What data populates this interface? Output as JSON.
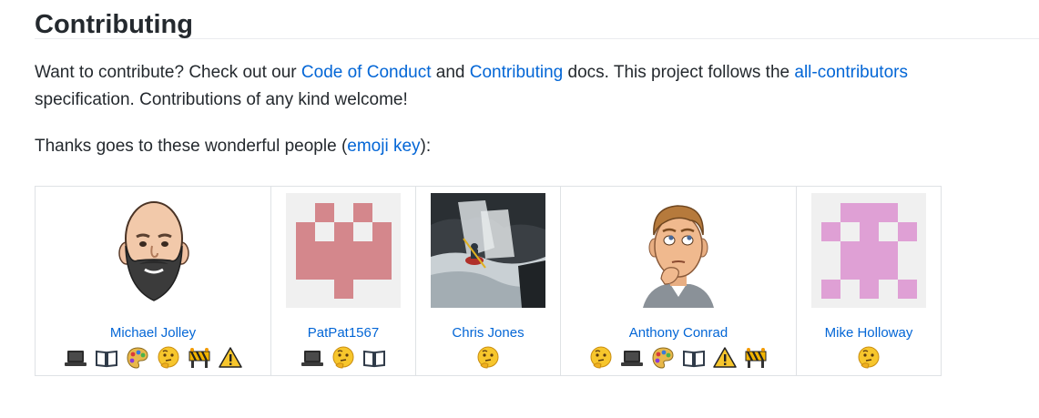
{
  "section": {
    "title": "Contributing"
  },
  "intro": {
    "text_1": "Want to contribute? Check out our ",
    "code_of_conduct_link": "Code of Conduct",
    "text_2": " and ",
    "contributing_link": "Contributing",
    "text_3": " docs. This project follows the ",
    "all_contributors_link": "all-contributors",
    "text_4": " specification. Contributions of any kind welcome!"
  },
  "thanks": {
    "text_1": "Thanks goes to these wonderful people (",
    "emoji_key_link": "emoji key",
    "text_2": "):"
  },
  "contributors": [
    {
      "name": "Michael Jolley",
      "contributions": [
        "laptop-icon",
        "book-icon",
        "palette-icon",
        "thinking-face-icon",
        "construction-icon",
        "warning-icon"
      ]
    },
    {
      "name": "PatPat1567",
      "contributions": [
        "laptop-icon",
        "thinking-face-icon",
        "book-icon"
      ]
    },
    {
      "name": "Chris Jones",
      "contributions": [
        "thinking-face-icon"
      ]
    },
    {
      "name": "Anthony Conrad",
      "contributions": [
        "thinking-face-icon",
        "laptop-icon",
        "palette-icon",
        "book-icon",
        "warning-icon",
        "construction-icon"
      ]
    },
    {
      "name": "Mike Holloway",
      "contributions": [
        "thinking-face-icon"
      ]
    }
  ],
  "colors": {
    "link": "#0366d6",
    "text": "#24292e",
    "identicon_pink": "#d4878c",
    "identicon_violet": "#dfa0d5",
    "identicon_bg": "#f0f0f0"
  }
}
